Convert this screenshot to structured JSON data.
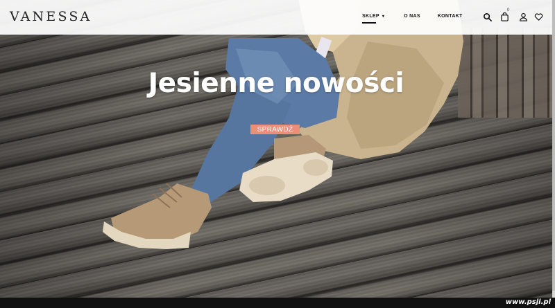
{
  "brand": {
    "logo": "VANESSA"
  },
  "nav": {
    "items": [
      {
        "label": "SKLEP",
        "active": true,
        "has_dropdown": true
      },
      {
        "label": "O NAS",
        "active": false,
        "has_dropdown": false
      },
      {
        "label": "KONTAKT",
        "active": false,
        "has_dropdown": false
      }
    ]
  },
  "header_icons": {
    "search": "search-icon",
    "cart": "cart-icon",
    "cart_count": "0",
    "account": "user-icon",
    "wishlist": "heart-icon"
  },
  "hero": {
    "headline": "Jesienne nowości",
    "cta_label": "SPRAWDŹ",
    "cta_color": "#eb8f7a"
  },
  "watermark": "www.psji.pl"
}
